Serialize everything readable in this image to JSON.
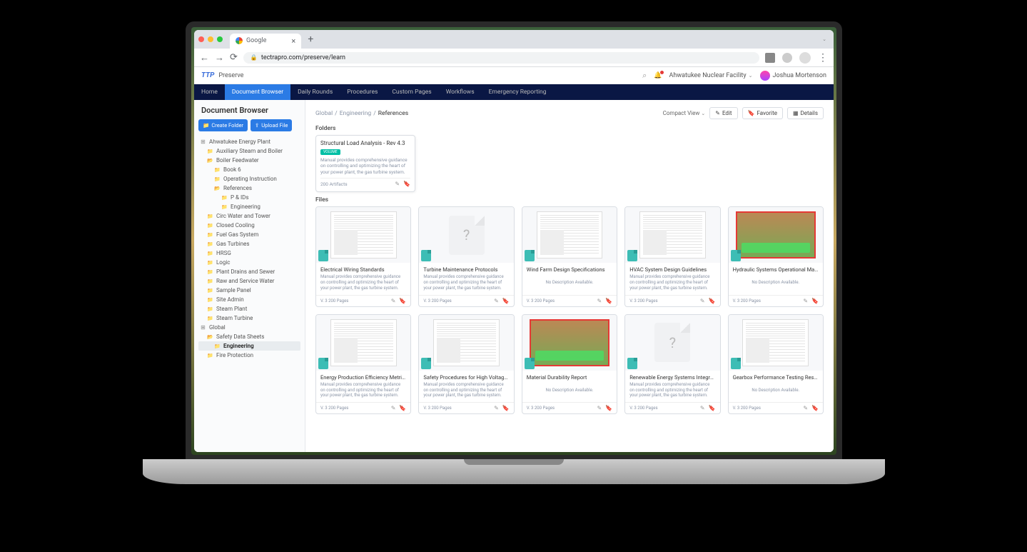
{
  "browser": {
    "tab_title": "Google",
    "url": "tectrapro.com/preserve/learn",
    "new_tab": "+"
  },
  "app": {
    "logo": "TTP",
    "brand": "Preserve",
    "location": "Ahwatukee Nuclear Facility",
    "user_name": "Joshua Mortenson"
  },
  "nav": {
    "items": [
      "Home",
      "Document Browser",
      "Daily Rounds",
      "Procedures",
      "Custom Pages",
      "Workflows",
      "Emergency Reporting"
    ],
    "active_index": 1
  },
  "sidebar": {
    "title": "Document Browser",
    "create_btn": "Create Folder",
    "upload_btn": "Upload File",
    "tree": [
      {
        "label": "Ahwatukee Energy Plant",
        "level": 0,
        "open": true,
        "type": "root"
      },
      {
        "label": "Auxiliary Steam and Boiler",
        "level": 1,
        "type": "folder"
      },
      {
        "label": "Boiler Feedwater",
        "level": 1,
        "type": "folder",
        "open": true
      },
      {
        "label": "Book 6",
        "level": 2,
        "type": "folder"
      },
      {
        "label": "Operating Instruction",
        "level": 2,
        "type": "folder"
      },
      {
        "label": "References",
        "level": 2,
        "type": "folder",
        "open": true
      },
      {
        "label": "P & IDs",
        "level": 3,
        "type": "folder"
      },
      {
        "label": "Engineering",
        "level": 3,
        "type": "folder"
      },
      {
        "label": "Circ Water and Tower",
        "level": 1,
        "type": "folder"
      },
      {
        "label": "Closed Cooling",
        "level": 1,
        "type": "folder"
      },
      {
        "label": "Fuel Gas System",
        "level": 1,
        "type": "folder"
      },
      {
        "label": "Gas Turbines",
        "level": 1,
        "type": "folder"
      },
      {
        "label": "HRSG",
        "level": 1,
        "type": "folder"
      },
      {
        "label": "Logic",
        "level": 1,
        "type": "folder"
      },
      {
        "label": "Plant Drains and Sewer",
        "level": 1,
        "type": "folder"
      },
      {
        "label": "Raw and Service Water",
        "level": 1,
        "type": "folder"
      },
      {
        "label": "Sample Panel",
        "level": 1,
        "type": "folder"
      },
      {
        "label": "Site Admin",
        "level": 1,
        "type": "folder"
      },
      {
        "label": "Steam Plant",
        "level": 1,
        "type": "folder"
      },
      {
        "label": "Steam Turbine",
        "level": 1,
        "type": "folder"
      },
      {
        "label": "Global",
        "level": 0,
        "type": "root",
        "open": true
      },
      {
        "label": "Safety Data Sheets",
        "level": 1,
        "type": "folder",
        "open": true
      },
      {
        "label": "Engineering",
        "level": 2,
        "type": "folder",
        "selected": true
      },
      {
        "label": "Fire Protection",
        "level": 1,
        "type": "folder"
      }
    ]
  },
  "breadcrumb": {
    "items": [
      "Global",
      "Engineering",
      "References"
    ]
  },
  "content": {
    "view_label": "Compact View",
    "edit_btn": "Edit",
    "favorite_btn": "Favorite",
    "details_btn": "Details",
    "folders_label": "Folders",
    "files_label": "Files",
    "folder": {
      "title": "Structural Load Analysis - Rev 4.3",
      "badge": "Volume",
      "desc": "Manual provides comprehensive guidance on controlling and optimizing the heart of your power plant, the gas turbine system.",
      "count": "200 Artifacts"
    },
    "common_desc": "Manual provides comprehensive guidance on controlling and optimizing the heart of your power plant, the gas turbine system.",
    "no_desc": "No Description Available.",
    "version": "V. 3",
    "pages": "200 Pages",
    "files": [
      {
        "title": "Electrical Wiring Standards",
        "thumb": "doc",
        "desc": true
      },
      {
        "title": "Turbine Maintenance Protocols",
        "thumb": "blank",
        "desc": true
      },
      {
        "title": "Wind Farm Design Specifications",
        "thumb": "doc",
        "desc": false
      },
      {
        "title": "HVAC System Design Guidelines",
        "thumb": "doc",
        "desc": true
      },
      {
        "title": "Hydraulic Systems Operational Manual",
        "thumb": "photo",
        "desc": false
      },
      {
        "title": "Energy Production Efficiency Metrics",
        "thumb": "doc",
        "desc": true
      },
      {
        "title": "Safety Procedures for High Voltage Sy...",
        "thumb": "doc",
        "desc": true
      },
      {
        "title": "Material Durability Report",
        "thumb": "photo",
        "desc": false
      },
      {
        "title": "Renewable Energy Systems Integratio...",
        "thumb": "blank",
        "desc": true
      },
      {
        "title": "Gearbox Performance Testing Results",
        "thumb": "doc",
        "desc": false
      }
    ]
  }
}
